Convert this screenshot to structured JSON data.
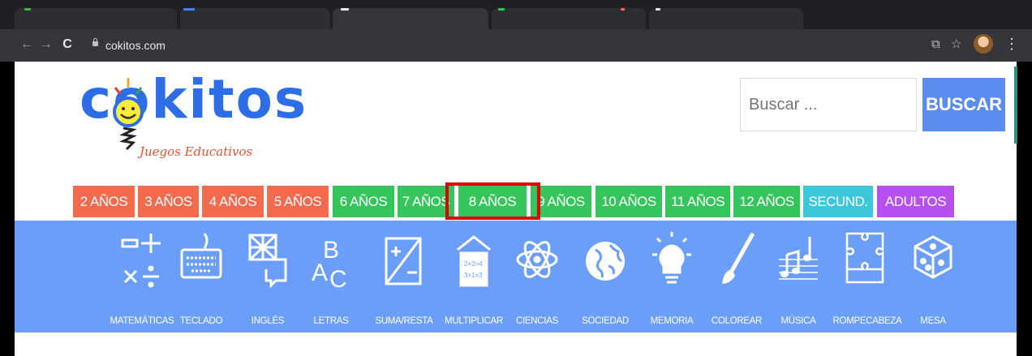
{
  "browser": {
    "url": "cokitos.com"
  },
  "logo": {
    "word_letters": [
      "c",
      "o",
      "k",
      "i",
      "t",
      "o",
      "s"
    ],
    "tagline": "Juegos Educativos"
  },
  "search": {
    "placeholder": "Buscar ...",
    "button_label": "BUSCAR"
  },
  "age_nav": [
    {
      "label": "2 AÑOS",
      "color": "#f46a4e"
    },
    {
      "label": "3 AÑOS",
      "color": "#f46a4e"
    },
    {
      "label": "4 AÑOS",
      "color": "#f46a4e"
    },
    {
      "label": "5 AÑOS",
      "color": "#f46a4e"
    },
    {
      "label": "6 AÑOS",
      "color": "#35c55c"
    },
    {
      "label": "7 AÑOS",
      "color": "#35c55c"
    },
    {
      "label": "8 AÑOS",
      "color": "#35c55c"
    },
    {
      "label": "9 AÑOS",
      "color": "#35c55c"
    },
    {
      "label": "10 AÑOS",
      "color": "#35c55c"
    },
    {
      "label": "11 AÑOS",
      "color": "#35c55c"
    },
    {
      "label": "12 AÑOS",
      "color": "#35c55c"
    },
    {
      "label": "SECUND.",
      "color": "#3dc6dc"
    },
    {
      "label": "ADULTOS",
      "color": "#b84ff0"
    }
  ],
  "categories": [
    {
      "label": "MATEMÁTICAS",
      "icon": "math-symbols-icon"
    },
    {
      "label": "TECLADO",
      "icon": "keyboard-icon"
    },
    {
      "label": "INGLÉS",
      "icon": "uk-flag-speech-icon"
    },
    {
      "label": "LETRAS",
      "icon": "abc-letters-icon"
    },
    {
      "label": "SUMA/RESTA",
      "icon": "plus-minus-icon"
    },
    {
      "label": "MULTIPLICAR",
      "icon": "multiplication-card-icon"
    },
    {
      "label": "CIENCIAS",
      "icon": "atom-icon"
    },
    {
      "label": "SOCIEDAD",
      "icon": "globe-icon"
    },
    {
      "label": "MEMORIA",
      "icon": "lightbulb-icon"
    },
    {
      "label": "COLOREAR",
      "icon": "paintbrush-icon"
    },
    {
      "label": "MÚSICA",
      "icon": "music-notes-icon"
    },
    {
      "label": "ROMPECABEZA",
      "icon": "puzzle-icon"
    },
    {
      "label": "MESA",
      "icon": "dice-icon"
    }
  ],
  "colors": {
    "search_button": "#5b8cf0",
    "category_bar": "#6a9ef8",
    "highlight_box": "#e00000"
  }
}
